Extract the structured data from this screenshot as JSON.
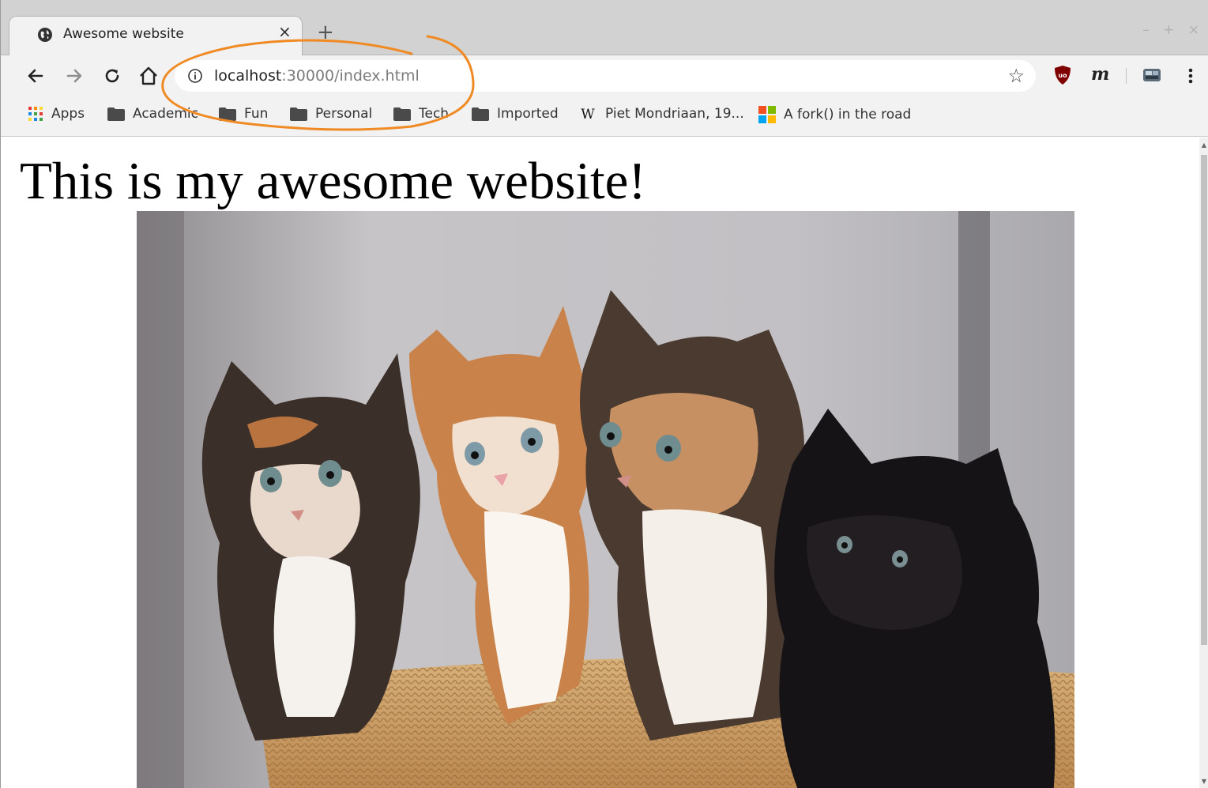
{
  "tab": {
    "title": "Awesome website",
    "close_label": "×",
    "new_tab_label": "+"
  },
  "window_controls": "– + ×",
  "omnibox": {
    "host": "localhost",
    "rest": ":30000/index.html"
  },
  "bookmarks": [
    {
      "label": "Apps",
      "icon": "apps-grid-icon"
    },
    {
      "label": "Academic",
      "icon": "folder-icon"
    },
    {
      "label": "Fun",
      "icon": "folder-icon"
    },
    {
      "label": "Personal",
      "icon": "folder-icon"
    },
    {
      "label": "Tech",
      "icon": "folder-icon"
    },
    {
      "label": "Imported",
      "icon": "folder-icon"
    },
    {
      "label": "Piet Mondriaan, 19...",
      "icon": "wikipedia-icon"
    },
    {
      "label": "A fork() in the road",
      "icon": "microsoft-icon"
    }
  ],
  "page": {
    "heading": "This is my awesome website!",
    "image_alt": "four kittens in a basket"
  },
  "colors": {
    "annotation_stroke": "#f08a24",
    "ublock_red": "#800000"
  }
}
